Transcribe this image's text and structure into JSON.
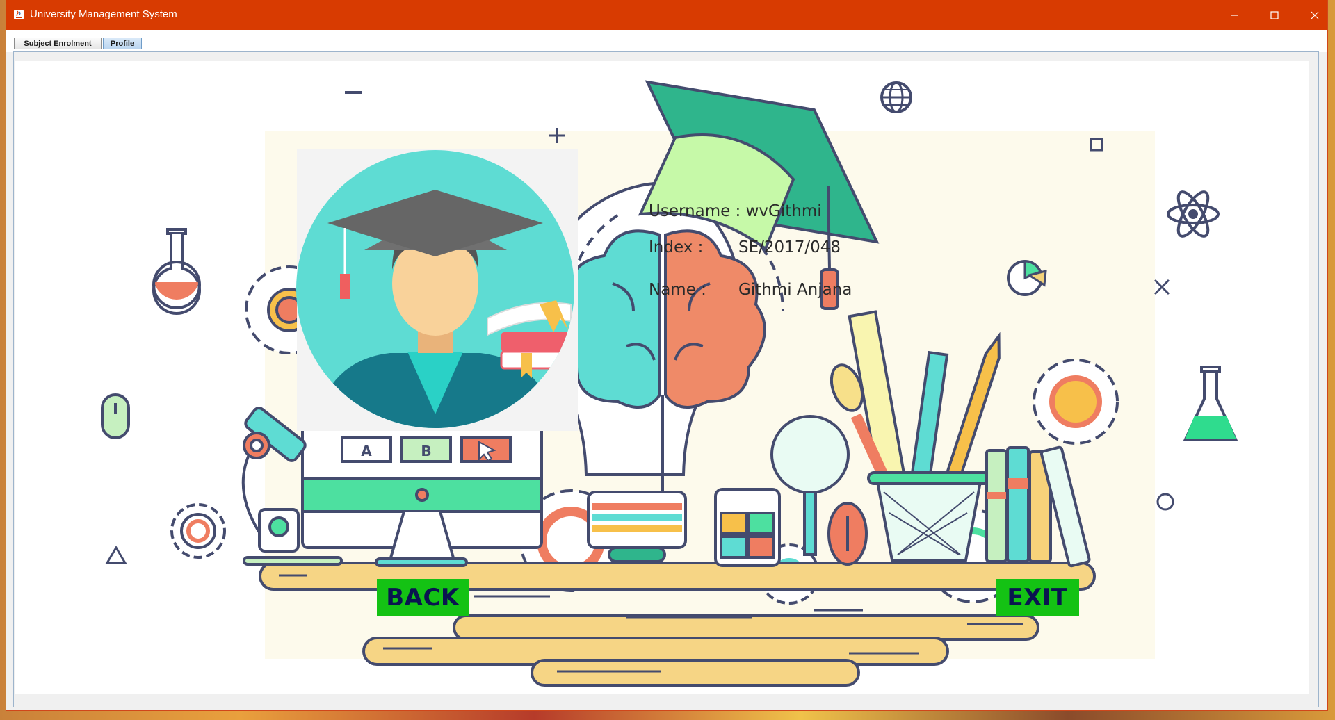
{
  "window": {
    "title": "University Management System",
    "controls": {
      "minimize": "–",
      "maximize": "☐",
      "close": "✕"
    }
  },
  "tabs": [
    {
      "label": "Subject Enrolment",
      "active": false
    },
    {
      "label": "Profile",
      "active": true
    }
  ],
  "profile": {
    "username_label": "Username :",
    "username_value": "wvGithmi",
    "index_label": "Index :",
    "index_value": "SE/2017/048",
    "name_label": "Name :",
    "name_value": "Githmi Anjana"
  },
  "buttons": {
    "back": "BACK",
    "exit": "EXIT"
  },
  "illustration": {
    "choice_a": "A",
    "choice_b": "B"
  },
  "colors": {
    "titlebar": "#d83b01",
    "button_bg": "#14c214",
    "button_text": "#0a1550",
    "avatar_circle": "#5edcd3"
  }
}
